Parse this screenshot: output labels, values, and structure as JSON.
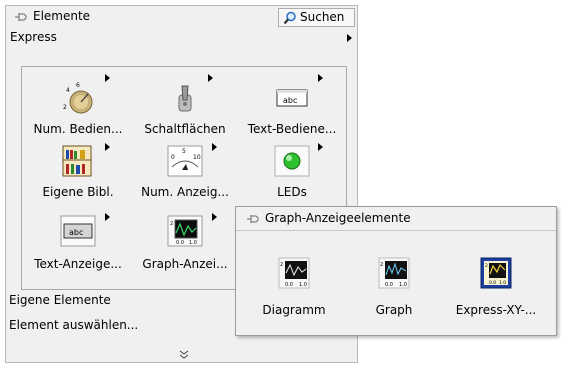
{
  "palette": {
    "title": "Elemente",
    "search_label": "Suchen",
    "category": "Express",
    "items": [
      {
        "label": "Num. Bedien...",
        "icon": "knob-icon"
      },
      {
        "label": "Schaltflächen",
        "icon": "toggle-switch-icon"
      },
      {
        "label": "Text-Bediene...",
        "icon": "text-control-icon"
      },
      {
        "label": "Eigene Bibl.",
        "icon": "library-books-icon"
      },
      {
        "label": "Num. Anzeig...",
        "icon": "gauge-icon"
      },
      {
        "label": "LEDs",
        "icon": "led-icon"
      },
      {
        "label": "Text-Anzeige...",
        "icon": "text-indicator-icon"
      },
      {
        "label": "Graph-Anzei...",
        "icon": "graph-indicator-icon"
      }
    ],
    "bottom": {
      "own_elements": "Eigene Elemente",
      "select_element": "Element auswählen..."
    }
  },
  "subpalette": {
    "title": "Graph-Anzeigeelemente",
    "items": [
      {
        "label": "Diagramm",
        "icon": "chart-icon"
      },
      {
        "label": "Graph",
        "icon": "graph-icon"
      },
      {
        "label": "Express-XY-...",
        "icon": "express-xy-graph-icon"
      }
    ]
  }
}
